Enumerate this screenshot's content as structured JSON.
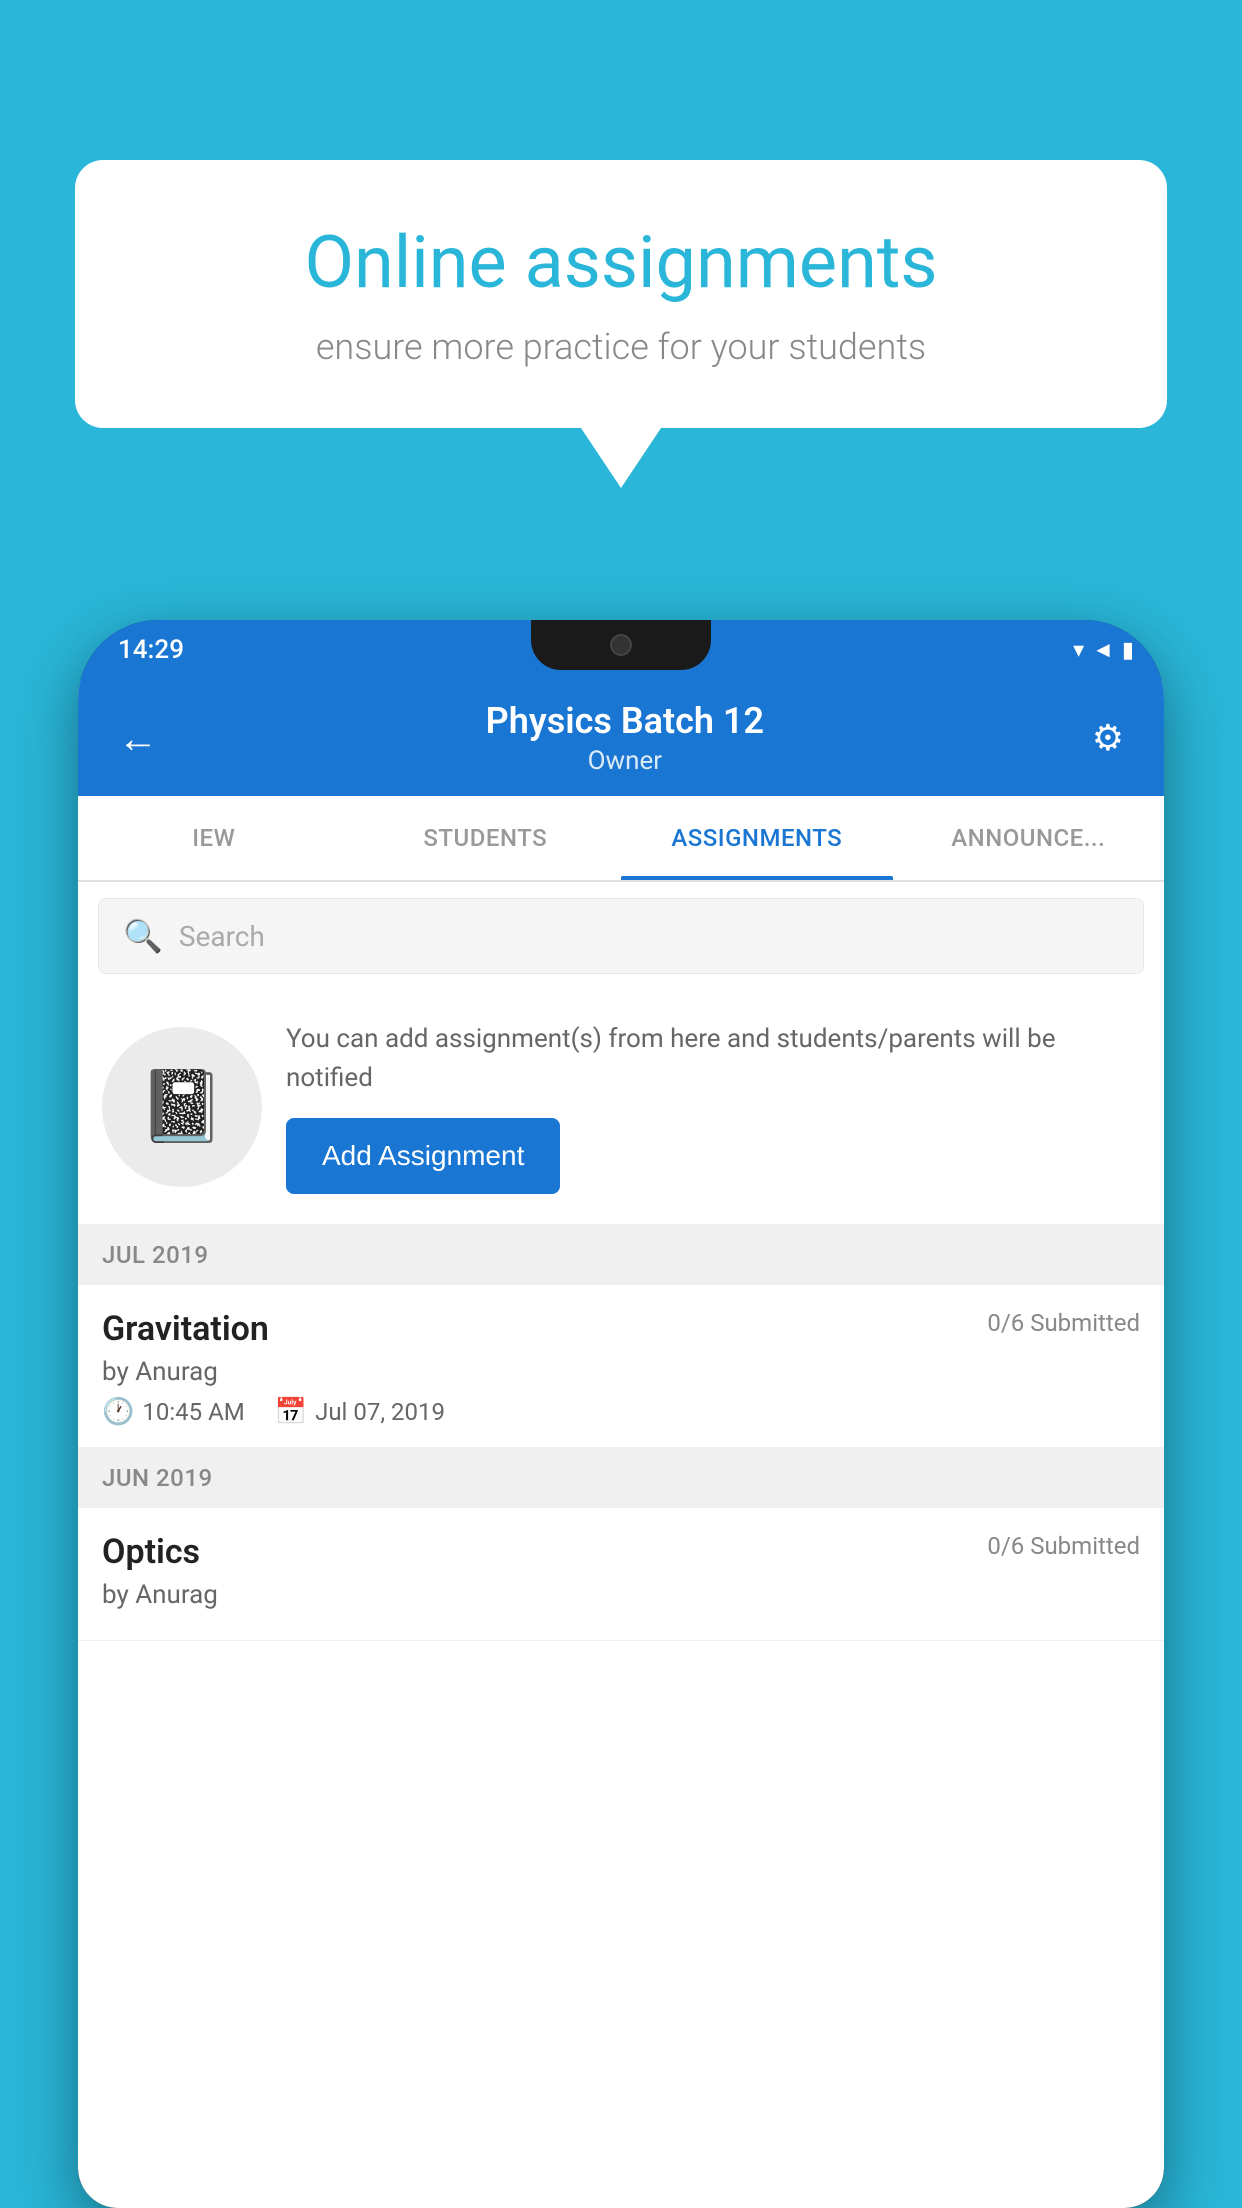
{
  "background_color": "#29b6d8",
  "speech_bubble": {
    "title": "Online assignments",
    "subtitle": "ensure more practice for your students"
  },
  "status_bar": {
    "time": "14:29",
    "signal_icon": "▼◄█",
    "wifi_icon": "▾"
  },
  "header": {
    "title": "Physics Batch 12",
    "subtitle": "Owner",
    "back_label": "←",
    "settings_label": "⚙"
  },
  "tabs": [
    {
      "label": "IEW",
      "active": false
    },
    {
      "label": "STUDENTS",
      "active": false
    },
    {
      "label": "ASSIGNMENTS",
      "active": true
    },
    {
      "label": "ANNOUNCEMENTS",
      "active": false
    }
  ],
  "search": {
    "placeholder": "Search"
  },
  "promo": {
    "description": "You can add assignment(s) from here and students/parents will be notified",
    "add_button_label": "Add Assignment"
  },
  "sections": [
    {
      "month_label": "JUL 2019",
      "assignments": [
        {
          "title": "Gravitation",
          "submitted": "0/6 Submitted",
          "author": "by Anurag",
          "time": "10:45 AM",
          "date": "Jul 07, 2019"
        }
      ]
    },
    {
      "month_label": "JUN 2019",
      "assignments": [
        {
          "title": "Optics",
          "submitted": "0/6 Submitted",
          "author": "by Anurag",
          "time": "",
          "date": ""
        }
      ]
    }
  ]
}
